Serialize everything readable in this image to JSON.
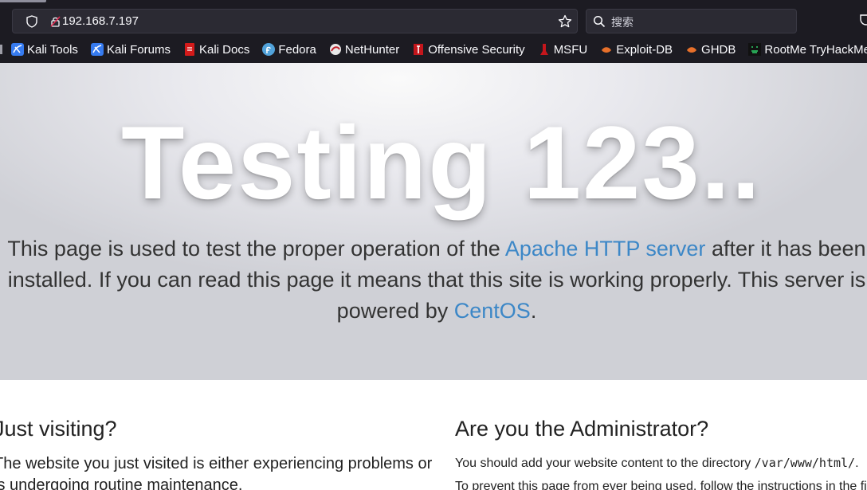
{
  "browser": {
    "url": "192.168.7.197",
    "search_placeholder": "搜索",
    "bookmarks": [
      {
        "label": "Kali Tools",
        "icon": "kali-icon"
      },
      {
        "label": "Kali Forums",
        "icon": "kali-icon"
      },
      {
        "label": "Kali Docs",
        "icon": "kali-docs-icon"
      },
      {
        "label": "Fedora",
        "icon": "fedora-icon"
      },
      {
        "label": "NetHunter",
        "icon": "nethunter-icon"
      },
      {
        "label": "Offensive Security",
        "icon": "offsec-icon"
      },
      {
        "label": "MSFU",
        "icon": "msfu-icon"
      },
      {
        "label": "Exploit-DB",
        "icon": "exploitdb-icon"
      },
      {
        "label": "GHDB",
        "icon": "ghdb-icon"
      },
      {
        "label": "RootMe TryHackMe W...",
        "icon": "rootme-icon"
      }
    ]
  },
  "page": {
    "title": "Testing 123..",
    "lead_before": "This page is used to test the proper operation of the ",
    "lead_link": "Apache HTTP server",
    "lead_after": " after it has been installed. If you can read this page it means that this site is working properly. This server is powered by ",
    "lead_link2": "CentOS",
    "lead_end": ".",
    "left_heading": "Just visiting?",
    "left_text": "The website you just visited is either experiencing problems or is undergoing routine maintenance.",
    "right_heading": "Are you the Administrator?",
    "right_p1_before": "You should add your website content to the directory ",
    "right_p1_code": "/var/www/html/",
    "right_p1_after": ".",
    "right_p2": "To prevent this page from ever being used, follow the instructions in the file"
  },
  "colors": {
    "chrome_bg": "#1c1b22",
    "urlbar_bg": "#2b2a33",
    "link": "#3c87c7",
    "body_text": "#333333"
  }
}
